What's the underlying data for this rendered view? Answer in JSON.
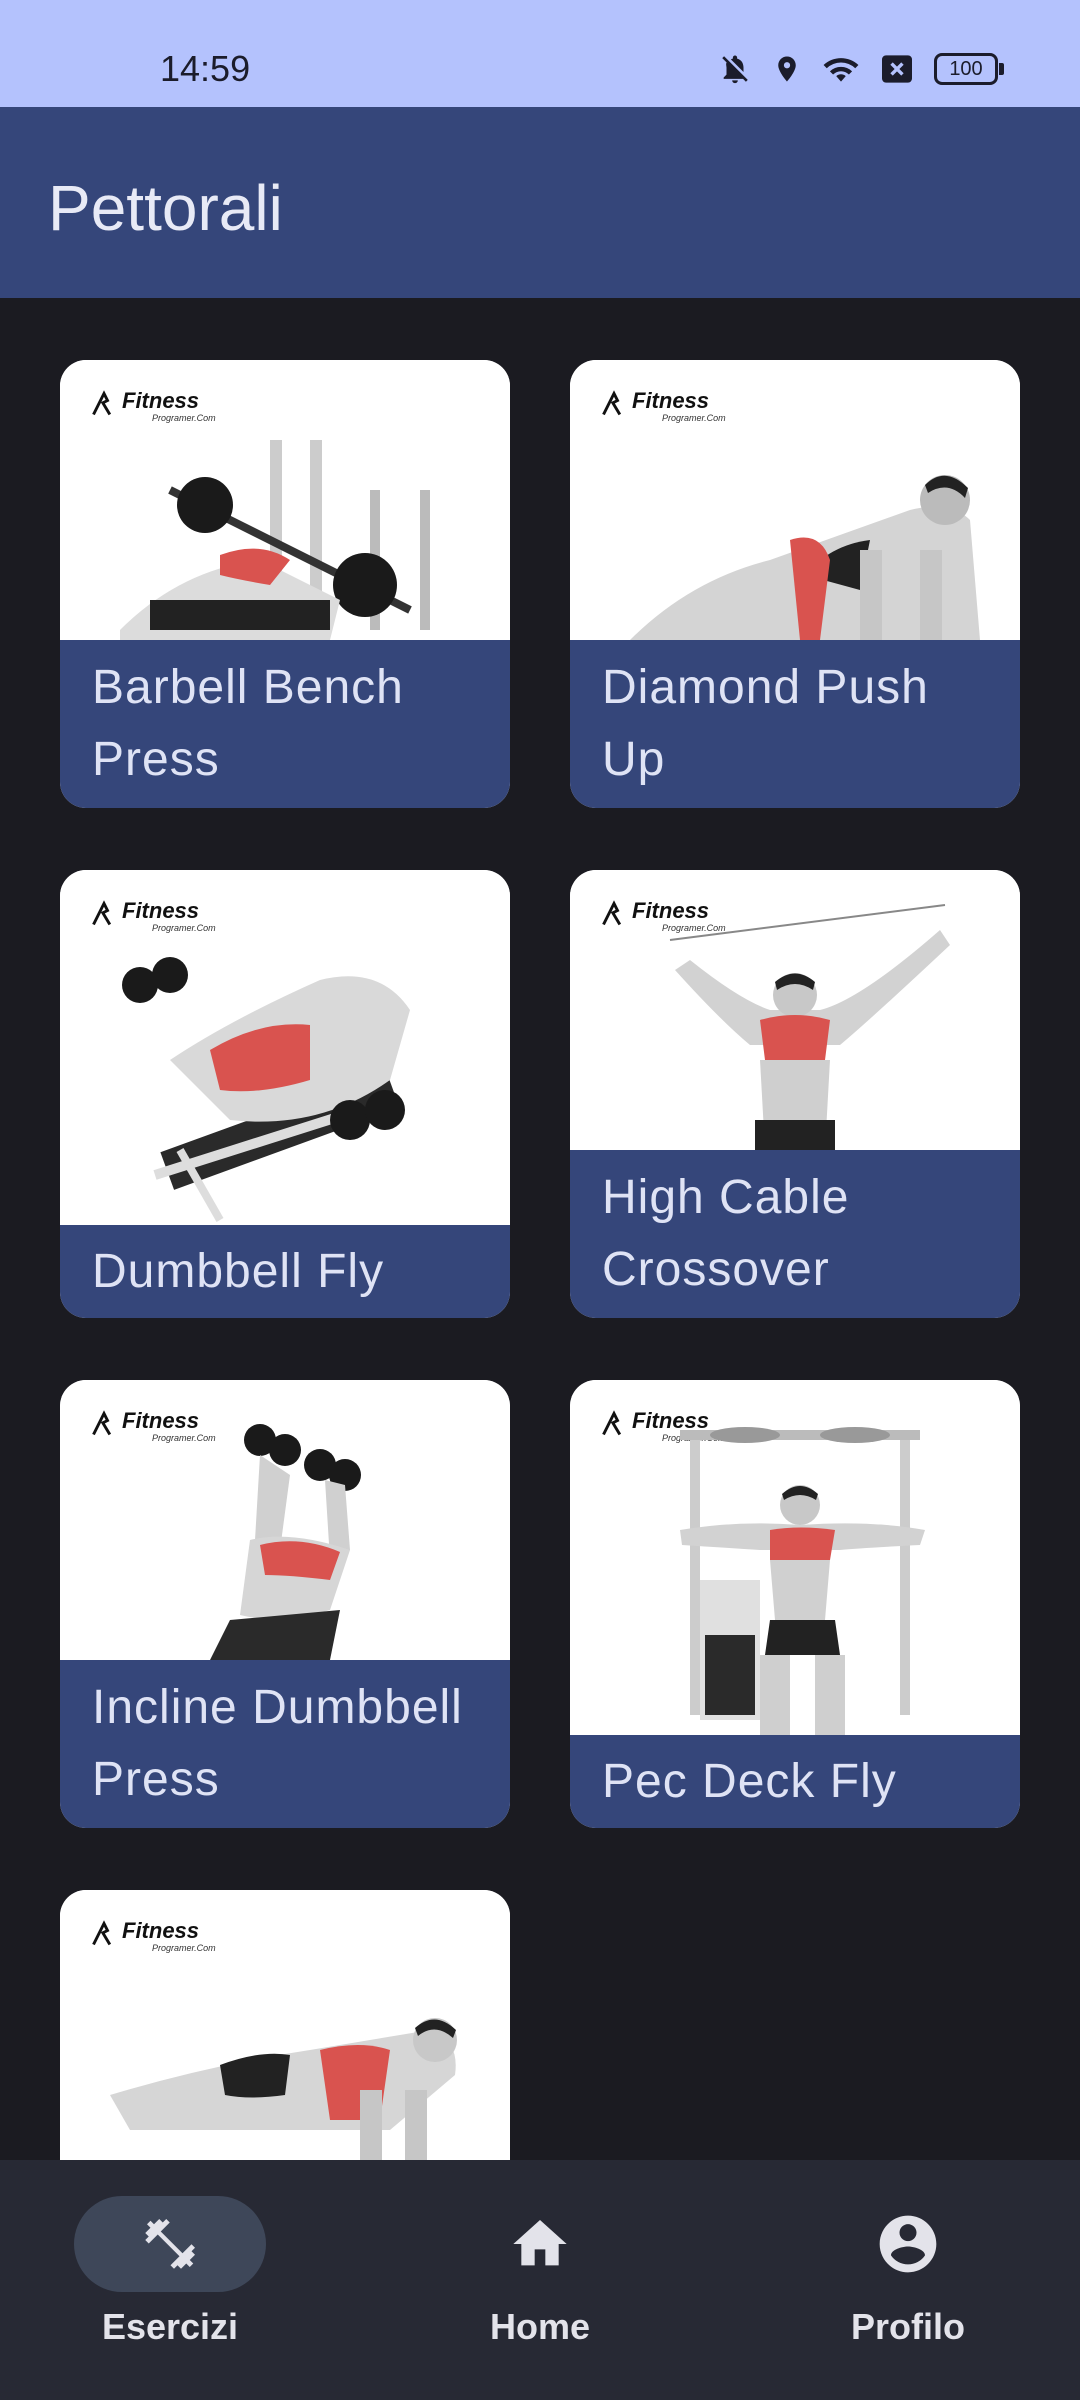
{
  "status_bar": {
    "time": "14:59",
    "battery": "100",
    "icons": [
      "bell-off-icon",
      "location-icon",
      "wifi-icon",
      "close-box-icon",
      "battery-icon"
    ]
  },
  "app_bar": {
    "title": "Pettorali"
  },
  "exercises": [
    {
      "label": "Barbell Bench Press",
      "brand": "Fitness",
      "brand_sub": "Programer.Com"
    },
    {
      "label": "Diamond Push Up",
      "brand": "Fitness",
      "brand_sub": "Programer.Com"
    },
    {
      "label": "Dumbbell Fly",
      "brand": "Fitness",
      "brand_sub": "Programer.Com"
    },
    {
      "label": "High Cable Crossover",
      "brand": "Fitness",
      "brand_sub": "Programer.Com"
    },
    {
      "label": "Incline Dumbbell Press",
      "brand": "Fitness",
      "brand_sub": "Programer.Com"
    },
    {
      "label": "Pec Deck Fly",
      "brand": "Fitness",
      "brand_sub": "Programer.Com"
    },
    {
      "label": "",
      "brand": "Fitness",
      "brand_sub": "Programer.Com"
    }
  ],
  "bottom_nav": {
    "items": [
      {
        "label": "Esercizi",
        "icon": "dumbbell-icon",
        "active": true
      },
      {
        "label": "Home",
        "icon": "home-icon",
        "active": false
      },
      {
        "label": "Profilo",
        "icon": "account-circle-icon",
        "active": false
      }
    ]
  },
  "colors": {
    "status_bar": "#b4c2fd",
    "app_bar": "#35467a",
    "background": "#1b1b21",
    "card_label": "#35467a",
    "bottom_nav": "#272934"
  }
}
